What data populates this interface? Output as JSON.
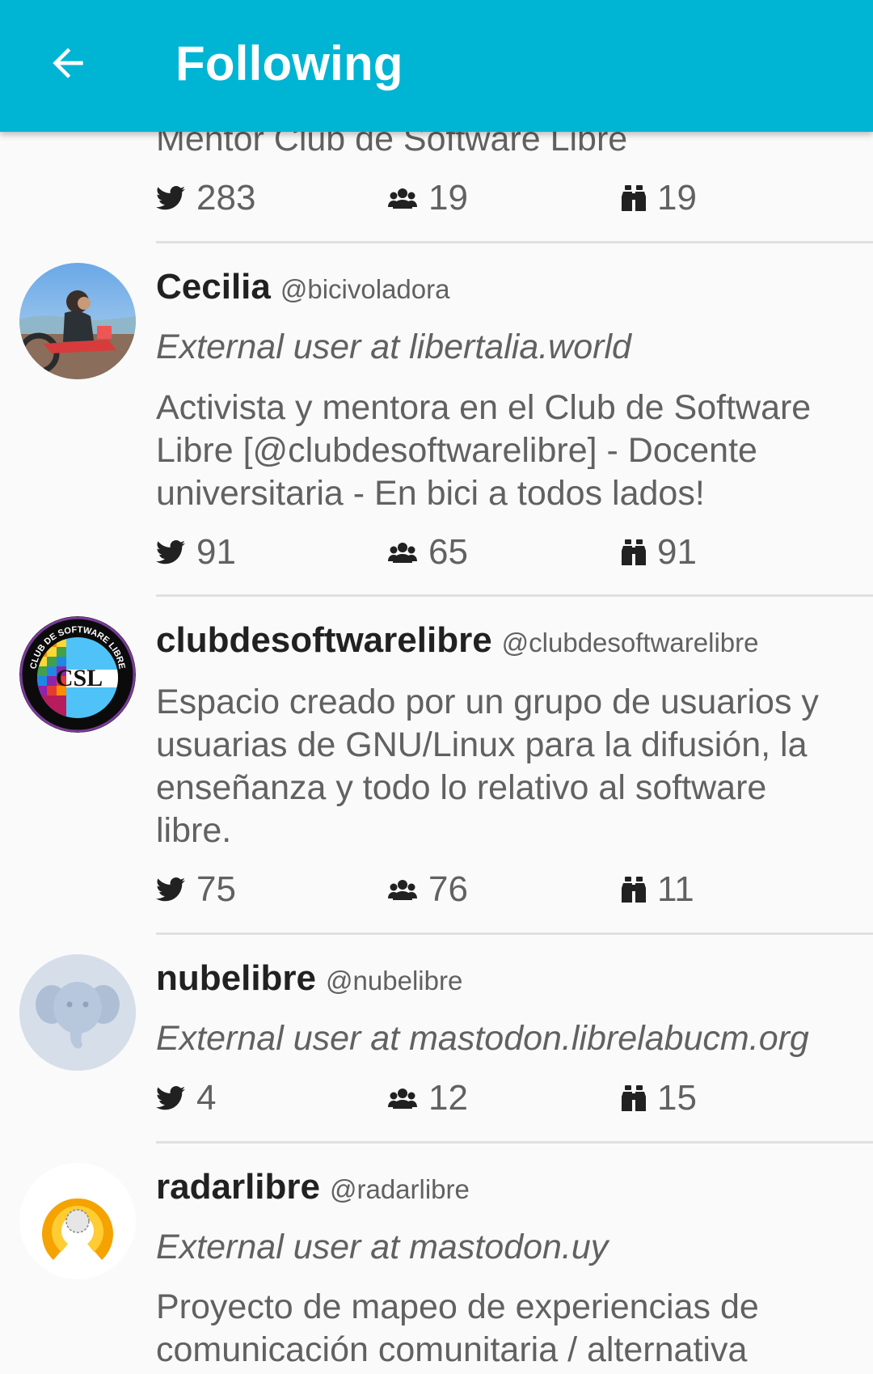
{
  "app_bar": {
    "title": "Following",
    "back_icon": "arrow-left-icon",
    "color": "#00b4d4"
  },
  "first_partial": {
    "bio_cutoff": "Mentor Club de Software Libre",
    "posts": "283",
    "following": "19",
    "followers": "19"
  },
  "users": [
    {
      "name": "Cecilia",
      "handle": "@bicivoladora",
      "external": "External user at libertalia.world",
      "bio": "Activista y mentora en el Club de Software Libre [@clubdesoftwarelibre] - Docente universitaria - En bici a todos lados!",
      "posts": "91",
      "following": "65",
      "followers": "91"
    },
    {
      "name": "clubdesoftwarelibre",
      "handle": "@clubdesoftwarelibre",
      "bio": "Espacio creado por un grupo de usuarios y usuarias de GNU/Linux para la difusión, la enseñanza y todo lo relativo al software libre.",
      "posts": "75",
      "following": "76",
      "followers": "11",
      "avatar_logo_text": "CSL",
      "avatar_ring_text": "CLUB DE SOFTWARE LIBRE"
    },
    {
      "name": "nubelibre",
      "handle": "@nubelibre",
      "external": "External user at mastodon.librelabucm.org",
      "posts": "4",
      "following": "12",
      "followers": "15"
    },
    {
      "name": "radarlibre",
      "handle": "@radarlibre",
      "external": "External user at mastodon.uy",
      "bio": "Proyecto de mapeo de experiencias de comunicación comunitaria / alternativa"
    }
  ],
  "icons": {
    "posts": "twitter-bird-icon",
    "following": "group-icon",
    "followers": "binoculars-icon"
  }
}
